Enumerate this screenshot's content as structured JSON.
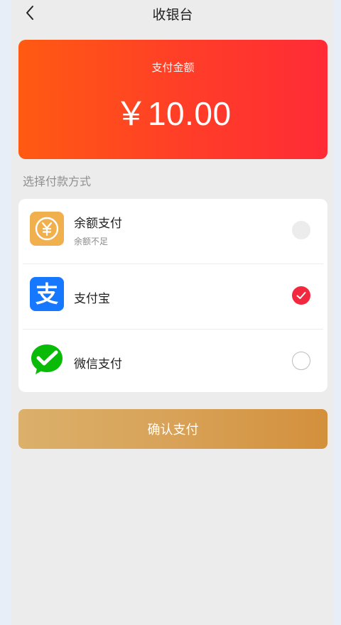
{
  "header": {
    "title": "收银台"
  },
  "amount": {
    "label": "支付金额",
    "value": "￥10.00"
  },
  "section": {
    "label": "选择付款方式"
  },
  "methods": [
    {
      "name": "余额支付",
      "sub": "余额不足",
      "icon": "balance-yen-icon",
      "state": "disabled"
    },
    {
      "name": "支付宝",
      "icon": "alipay-icon",
      "state": "checked"
    },
    {
      "name": "微信支付",
      "icon": "wechat-pay-icon",
      "state": "unchecked"
    }
  ],
  "confirm": {
    "label": "确认支付"
  },
  "colors": {
    "amount_start": "#ff5a12",
    "amount_end": "#ff2b36",
    "checked": "#f2283e",
    "button_start": "#dbb06a",
    "button_end": "#d3903c",
    "alipay": "#1677ff",
    "wechat": "#09bb07",
    "balance": "#f0b04e"
  }
}
